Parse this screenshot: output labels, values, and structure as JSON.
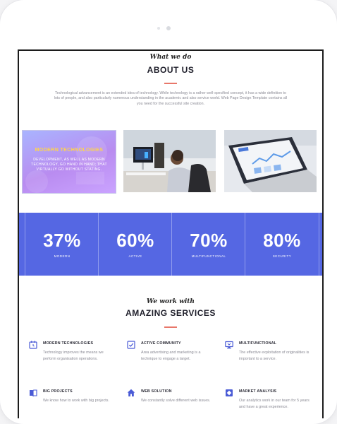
{
  "about": {
    "script": "What we do",
    "title": "ABOUT US",
    "text": "Technological advancement is an extended idea of technology. While technology is a rather well-specified concept, it has a wide definition to lots of people, and also particularly numerous understanding in the academic and also service world. Web Page Design Template contains all you need for the successful site creation."
  },
  "cards": {
    "heading": "MODERN TECHNOLOGIES",
    "body": "DEVELOPMENT, AS WELL AS MODERN TECHNOLOGY, GO HAND IN HAND; THAT VIRTUALLY GO WITHOUT STATING."
  },
  "stats": [
    {
      "value": "37%",
      "label": "MODERN"
    },
    {
      "value": "60%",
      "label": "ACTIVE"
    },
    {
      "value": "70%",
      "label": "MULTIFUNCTIONAL"
    },
    {
      "value": "80%",
      "label": "SECURITY"
    }
  ],
  "services": {
    "script": "We work with",
    "title": "AMAZING SERVICES",
    "items": [
      {
        "icon": "clock-icon",
        "title": "MODERN TECHNOLOGIES",
        "desc": "Technology improves the means we perform organisation operations."
      },
      {
        "icon": "checkbox-icon",
        "title": "ACTIVE COMMUNITY",
        "desc": "Area advertising and marketing is a technique to engage a target."
      },
      {
        "icon": "monitor-icon",
        "title": "MULTIFUNCTIONAL",
        "desc": "The effective exploitation of originalities is important to a service."
      },
      {
        "icon": "book-icon",
        "title": "BIG PROJECTS",
        "desc": "We know how to work with big projects."
      },
      {
        "icon": "home-icon",
        "title": "WEB SOLUTION",
        "desc": "We constantly solve different web issues."
      },
      {
        "icon": "diamond-icon",
        "title": "MARKET ANALYSIS",
        "desc": "Our analytics work in our team for 5 years and have a great experience."
      }
    ]
  },
  "colors": {
    "accent": "#5567e3",
    "rule": "#e8776a",
    "highlight": "#ffd54a"
  }
}
